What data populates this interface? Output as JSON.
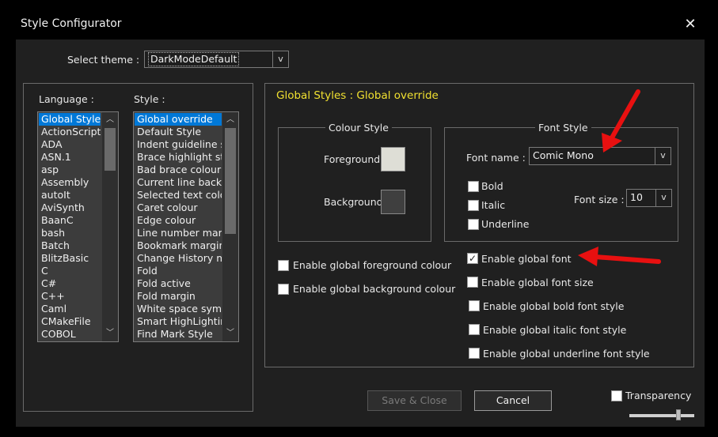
{
  "window": {
    "title": "Style Configurator",
    "close_glyph": "✕"
  },
  "theme": {
    "label": "Select theme :",
    "value": "DarkModeDefault",
    "arrow": "v"
  },
  "language": {
    "label": "Language :",
    "items": [
      "Global Styles",
      "ActionScript",
      "ADA",
      "ASN.1",
      "asp",
      "Assembly",
      "autoIt",
      "AviSynth",
      "BaanC",
      "bash",
      "Batch",
      "BlitzBasic",
      "C",
      "C#",
      "C++",
      "Caml",
      "CMakeFile",
      "COBOL"
    ]
  },
  "style": {
    "label": "Style :",
    "items": [
      "Global override",
      "Default Style",
      "Indent guideline st",
      "Brace highlight styl",
      "Bad brace colour",
      "Current line backgr",
      "Selected text colou",
      "Caret colour",
      "Edge colour",
      "Line number marg",
      "Bookmark margin",
      "Change History ma",
      "Fold",
      "Fold active",
      "Fold margin",
      "White space symbo",
      "Smart HighLighting",
      "Find Mark Style"
    ]
  },
  "section_title": "Global Styles : Global override",
  "colour_style": {
    "legend": "Colour Style",
    "foreground_label": "Foreground",
    "background_label": "Background",
    "foreground_color": "#deded6",
    "background_color": "#3f3f3f"
  },
  "font_style": {
    "legend": "Font Style",
    "font_name_label": "Font name :",
    "font_name_value": "Comic Mono",
    "bold_label": "Bold",
    "italic_label": "Italic",
    "underline_label": "Underline",
    "font_size_label": "Font size :",
    "font_size_value": "10",
    "arrow": "v"
  },
  "global_options": {
    "enable_fg_colour": "Enable global foreground colour",
    "enable_bg_colour": "Enable global background colour",
    "enable_font": "Enable global font",
    "enable_font_checked": "✓",
    "enable_font_size": "Enable global font size",
    "enable_bold": "Enable global bold font style",
    "enable_italic": "Enable global italic font style",
    "enable_underline": "Enable global underline font style"
  },
  "buttons": {
    "save_close": "Save & Close",
    "cancel": "Cancel"
  },
  "transparency": {
    "label": "Transparency",
    "slider_value": 0.75
  },
  "colors": {
    "accent_title": "#f0e030",
    "selection": "#0078d7",
    "arrow": "#e81010"
  }
}
